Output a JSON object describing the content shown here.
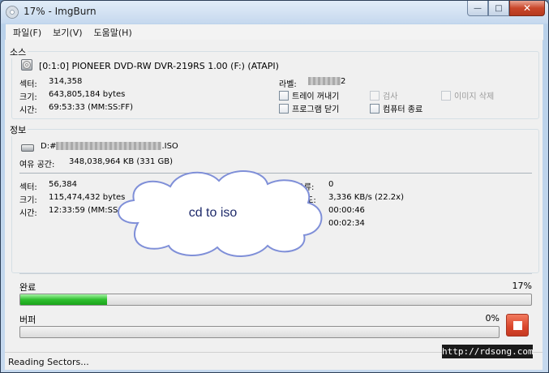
{
  "window": {
    "title": "17% - ImgBurn",
    "buttons": {
      "minimize": "—",
      "maximize": "□",
      "close": "✕"
    }
  },
  "menu": [
    "파일(F)",
    "보기(V)",
    "도움말(H)"
  ],
  "source": {
    "title": "소스",
    "drive": "[0:1:0] PIONEER DVD-RW  DVR-219RS 1.00 (F:) (ATAPI)",
    "sectors_label": "섹터:",
    "sectors_value": "314,358",
    "size_label": "크기:",
    "size_value": "643,805,184 bytes",
    "time_label": "시간:",
    "time_value": "69:53:33 (MM:SS:FF)",
    "label_label": "라벨:",
    "label_value_suffix": "2",
    "checkboxes": [
      {
        "label": "트레이 꺼내기",
        "checked": false,
        "enabled": true
      },
      {
        "label": "검사",
        "checked": false,
        "enabled": false
      },
      {
        "label": "이미지 삭제",
        "checked": false,
        "enabled": false
      },
      {
        "label": "프로그램 닫기",
        "checked": false,
        "enabled": true
      },
      {
        "label": "컴퓨터 종료",
        "checked": false,
        "enabled": true
      }
    ]
  },
  "info": {
    "title": "정보",
    "dest_prefix": "D:#",
    "dest_suffix": ".ISO",
    "free_label": "여유 공간:",
    "free_value": "348,038,964 KB  (331 GB)",
    "sectors_label": "섹터:",
    "sectors_value": "56,384",
    "size_label": "크기:",
    "size_value": "115,474,432 bytes",
    "time_label": "시간:",
    "time_value": "12:33:59 (MM:SS:F",
    "read_errors_label": "읽기 오류:",
    "read_errors_value": "0",
    "speed_label": "속도:",
    "speed_value": "3,336 KB/s (22.2x)",
    "elapsed_value": "00:00:46",
    "remaining_value": "00:02:34"
  },
  "overlay": {
    "cloud_text": "cd to iso"
  },
  "progress": {
    "complete_label": "완료",
    "complete_percent": "17%",
    "complete_fraction": 0.17,
    "buffer_label": "버퍼",
    "buffer_percent": "0%",
    "buffer_fraction": 0
  },
  "status": "Reading Sectors...",
  "watermark": "http://rdsong.com"
}
